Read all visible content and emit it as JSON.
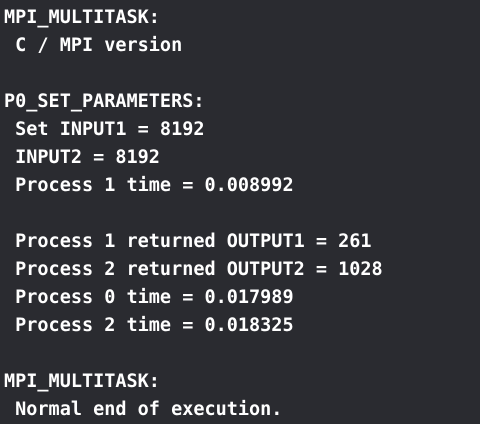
{
  "terminal": {
    "lines": [
      "MPI_MULTITASK:",
      " C / MPI version",
      "",
      "P0_SET_PARAMETERS:",
      " Set INPUT1 = 8192",
      " INPUT2 = 8192",
      " Process 1 time = 0.008992",
      "",
      " Process 1 returned OUTPUT1 = 261",
      " Process 2 returned OUTPUT2 = 1028",
      " Process 0 time = 0.017989",
      " Process 2 time = 0.018325",
      "",
      "MPI_MULTITASK:",
      " Normal end of execution."
    ]
  },
  "colors": {
    "background": "#2a2b30",
    "text": "#ffffff"
  }
}
